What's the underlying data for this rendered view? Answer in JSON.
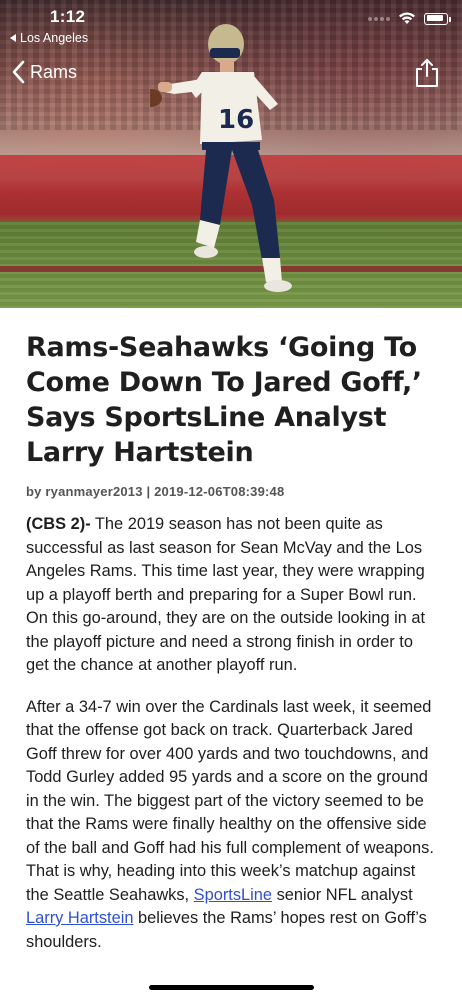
{
  "status_bar": {
    "time": "1:12",
    "back_app_label": "Los Angeles",
    "battery_level": 0.9
  },
  "nav": {
    "back_label": "Rams",
    "share_icon": "share-icon",
    "back_icon": "chevron-left-icon"
  },
  "hero": {
    "image_subject": "rams-quarterback-photo"
  },
  "article": {
    "headline": "Rams-Seahawks ‘Going To Come Down To Jared Goff,’ Says SportsLine Analyst Larry Hartstein",
    "byline": "by ryanmayer2013 | 2019-12-06T08:39:48",
    "p1_lead": "(CBS 2)-",
    "p1_text": " The 2019 season has not been quite as successful as last season for Sean McVay and the Los Angeles Rams. This time last year, they were wrapping up a playoff berth and preparing for a Super Bowl run. On this go-around, they are on the outside looking in at the playoff picture and need a strong finish in order to get the chance at another playoff run.",
    "p2_text_a": "After a 34-7 win over the Cardinals last week, it seemed that the offense got back on track. Quarterback Jared Goff threw for over 400 yards and two touchdowns, and Todd Gurley added 95 yards and a score on the ground in the win. The biggest part of the victory seemed to be that the Rams were finally healthy on the offensive side of the ball and Goff had his full complement of weapons. That is why, heading into this week’s matchup against the Seattle Seahawks, ",
    "p2_link1": "SportsLine",
    "p2_text_b": " senior NFL analyst ",
    "p2_link2": "Larry Hartstein",
    "p2_text_c": " believes the Rams’ hopes rest on Goff’s shoulders."
  },
  "colors": {
    "link": "#2f4fd4",
    "text": "#1e1e1e",
    "byline": "#555555"
  }
}
